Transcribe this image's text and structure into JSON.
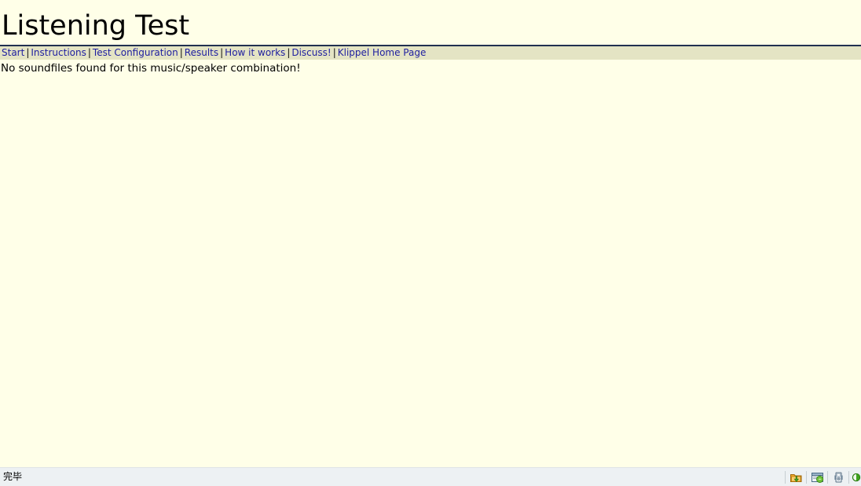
{
  "page": {
    "title": "Listening Test",
    "message": "No soundfiles found for this music/speaker combination!"
  },
  "navbar": {
    "separator": "|",
    "items": [
      {
        "label": "Start"
      },
      {
        "label": "Instructions"
      },
      {
        "label": "Test Configuration"
      },
      {
        "label": "Results"
      },
      {
        "label": "How it works"
      },
      {
        "label": "Discuss!"
      },
      {
        "label": "Klippel Home Page"
      }
    ]
  },
  "statusbar": {
    "text": "完毕",
    "icons": [
      {
        "name": "download-manager-icon"
      },
      {
        "name": "popup-blocker-icon"
      },
      {
        "name": "server-icon"
      },
      {
        "name": "security-zone-icon"
      }
    ]
  },
  "colors": {
    "page_background": "#ffffe8",
    "navbar_background": "#e4e4c4",
    "link": "#2020a0",
    "rule": "#203050",
    "statusbar_background": "#edf1f3",
    "text": "#000000"
  }
}
